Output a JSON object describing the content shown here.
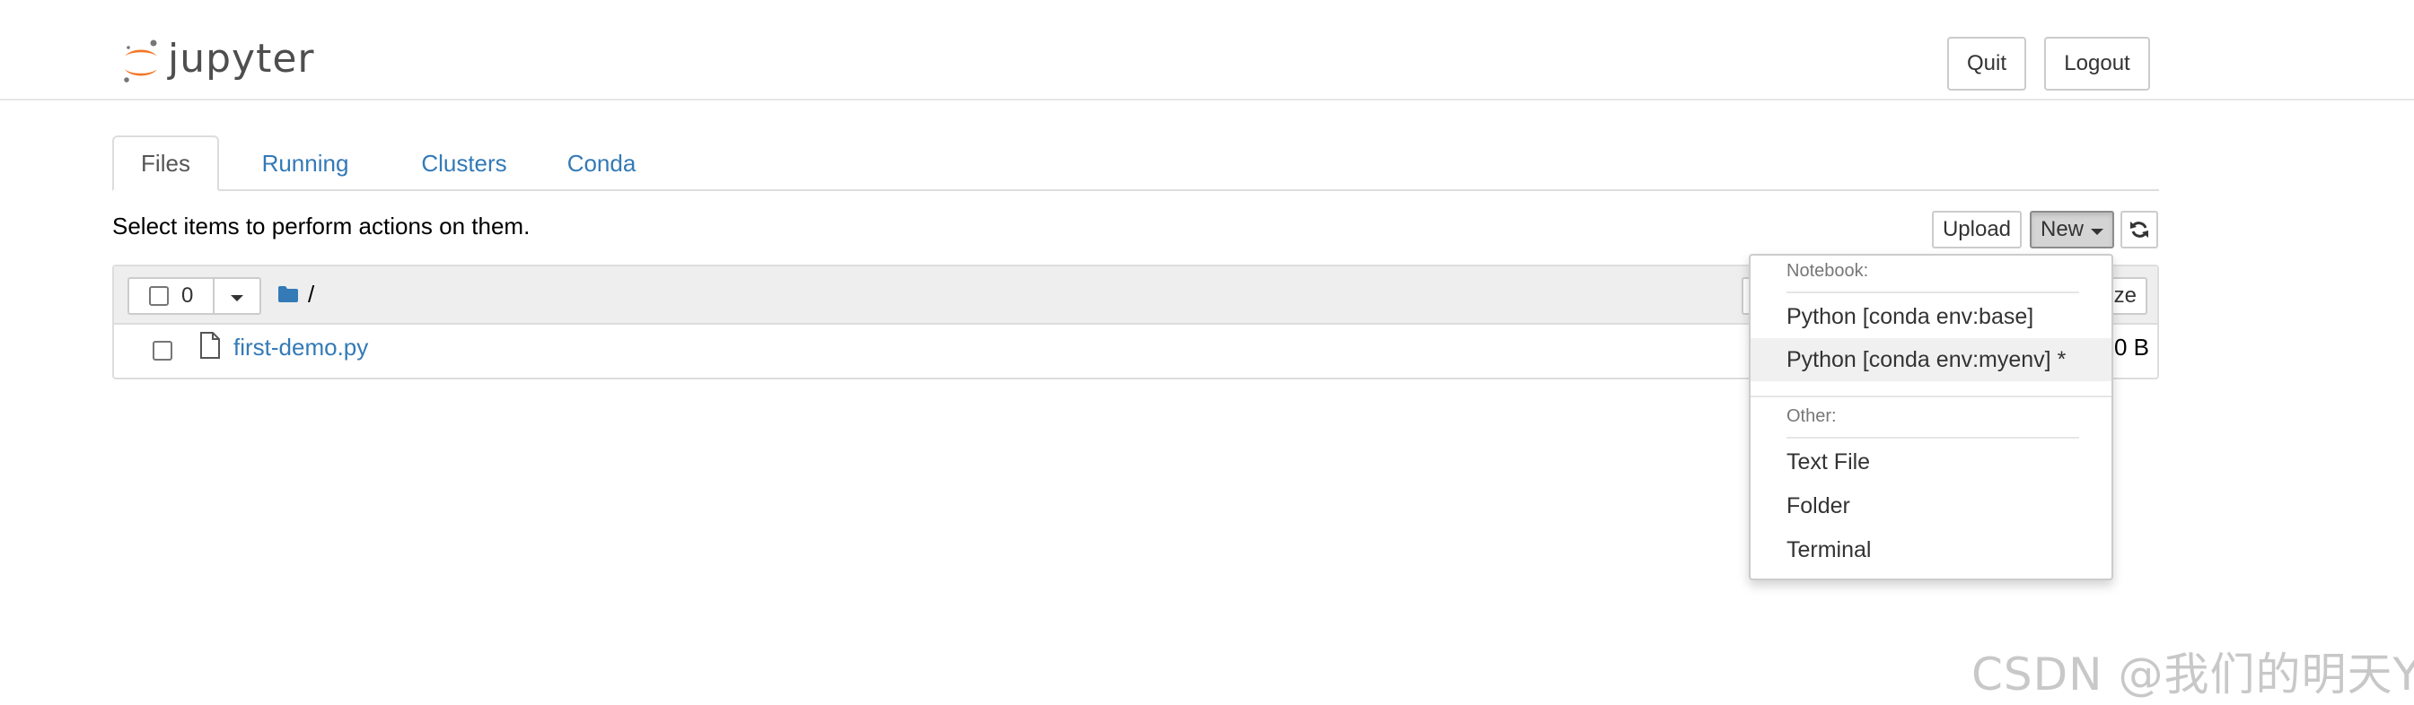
{
  "header": {
    "logo_text": "jupyter",
    "quit_label": "Quit",
    "logout_label": "Logout",
    "logo_colors": {
      "orange": "#f37726",
      "gray": "#767677"
    }
  },
  "tabs": [
    {
      "label": "Files",
      "active": true
    },
    {
      "label": "Running",
      "active": false
    },
    {
      "label": "Clusters",
      "active": false
    },
    {
      "label": "Conda",
      "active": false
    }
  ],
  "toolbar": {
    "hint": "Select items to perform actions on them.",
    "upload_label": "Upload",
    "new_label": "New",
    "refresh_icon": "refresh-icon"
  },
  "file_list": {
    "selected_count": "0",
    "breadcrumb_path": "/",
    "size_button_label": "ze",
    "files": [
      {
        "name": "first-demo.py",
        "size": "0 B",
        "icon": "file-icon"
      }
    ]
  },
  "new_menu": {
    "notebook_header": "Notebook:",
    "notebook_items": [
      {
        "label": "Python [conda env:base]",
        "active": false
      },
      {
        "label": "Python [conda env:myenv] *",
        "active": true
      }
    ],
    "other_header": "Other:",
    "other_items": [
      {
        "label": "Text File"
      },
      {
        "label": "Folder"
      },
      {
        "label": "Terminal"
      }
    ]
  },
  "colors": {
    "link": "#337ab7",
    "accent_orange": "#f37726"
  },
  "watermark": "CSDN @我们的明天Y"
}
